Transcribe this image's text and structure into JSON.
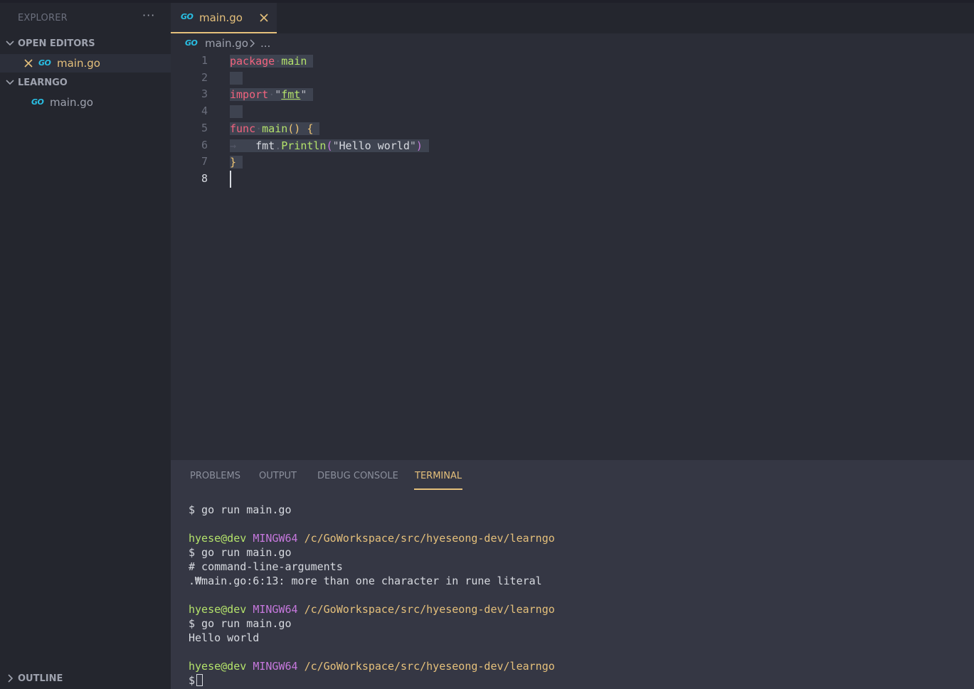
{
  "sidebar": {
    "header": "EXPLORER",
    "more": "···",
    "open_editors_label": "OPEN EDITORS",
    "open_editors": [
      {
        "icon": "GO",
        "name": "main.go"
      }
    ],
    "folder_label": "LEARNGO",
    "files": [
      {
        "icon": "GO",
        "name": "main.go"
      }
    ],
    "outline_label": "OUTLINE"
  },
  "tabs": [
    {
      "icon": "GO",
      "label": "main.go",
      "active": true
    }
  ],
  "breadcrumb": {
    "icon": "GO",
    "file": "main.go",
    "more": "..."
  },
  "editor": {
    "line_numbers": [
      "1",
      "2",
      "3",
      "4",
      "5",
      "6",
      "7",
      "8"
    ],
    "current_line": "8",
    "lines": {
      "l1_kw": "package",
      "l1_name": "main",
      "l3_kw": "import",
      "l3_pkg": "fmt",
      "l5_kw": "func",
      "l5_name": "main",
      "l5_rest": "() {",
      "l6_ws": "→",
      "l6_obj": "fmt",
      "l6_method": "Println",
      "l6_str": "Hello world",
      "l7_brace": "}"
    }
  },
  "panel": {
    "tabs": [
      "PROBLEMS",
      "OUTPUT",
      "DEBUG CONSOLE",
      "TERMINAL"
    ],
    "active_tab": "TERMINAL",
    "terminal": {
      "user": "hyese@dev",
      "host": "MINGW64",
      "path": "/c/GoWorkspace/src/hyeseong-dev/learngo",
      "cmd1": "$ go run main.go",
      "cmd2": "$ go run main.go",
      "err1": "# command-line-arguments",
      "err2": ".₩main.go:6:13: more than one character in rune literal",
      "cmd3": "$ go run main.go",
      "out3": "Hello world",
      "prompt": "$"
    }
  },
  "colors": {
    "accent": "#e5c07b",
    "go_icon": "#29bfe4",
    "keyword": "#f2637e",
    "function": "#b4e36b"
  }
}
